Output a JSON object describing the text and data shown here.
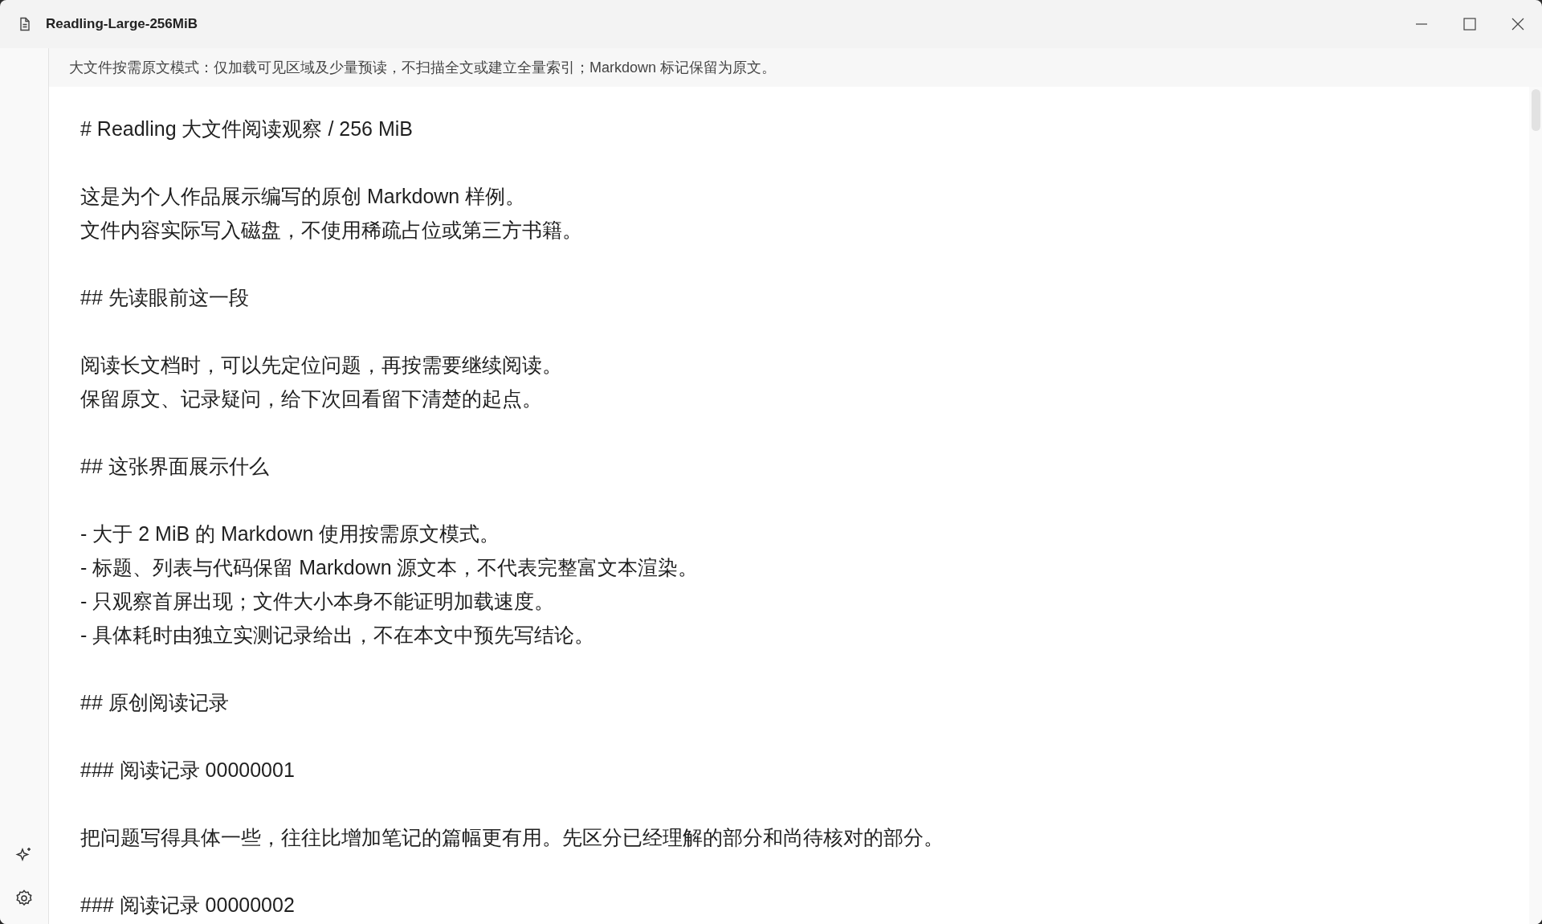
{
  "window": {
    "title": "Readling-Large-256MiB"
  },
  "banner": "大文件按需原文模式：仅加载可见区域及少量预读，不扫描全文或建立全量索引；Markdown 标记保留为原文。",
  "document": {
    "blocks": [
      [
        "# Readling 大文件阅读观察 / 256 MiB"
      ],
      [
        "这是为个人作品展示编写的原创 Markdown 样例。",
        "文件内容实际写入磁盘，不使用稀疏占位或第三方书籍。"
      ],
      [
        "## 先读眼前这一段"
      ],
      [
        "阅读长文档时，可以先定位问题，再按需要继续阅读。",
        "保留原文、记录疑问，给下次回看留下清楚的起点。"
      ],
      [
        "## 这张界面展示什么"
      ],
      [
        "- 大于 2 MiB 的 Markdown 使用按需原文模式。",
        "- 标题、列表与代码保留 Markdown 源文本，不代表完整富文本渲染。",
        "- 只观察首屏出现；文件大小本身不能证明加载速度。",
        "- 具体耗时由独立实测记录给出，不在本文中预先写结论。"
      ],
      [
        "## 原创阅读记录"
      ],
      [
        "### 阅读记录 00000001"
      ],
      [
        "把问题写得具体一些，往往比增加笔记的篇幅更有用。先区分已经理解的部分和尚待核对的部分。"
      ],
      [
        "### 阅读记录 00000002"
      ]
    ]
  }
}
